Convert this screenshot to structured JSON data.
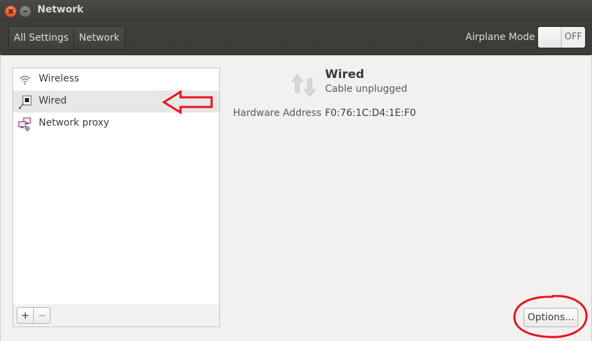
{
  "window": {
    "title": "Network"
  },
  "toolbar": {
    "breadcrumbs": [
      {
        "label": "All Settings"
      },
      {
        "label": "Network"
      }
    ],
    "airplane_mode": {
      "label": "Airplane Mode",
      "state": "OFF"
    }
  },
  "sidebar": {
    "items": [
      {
        "label": "Wireless",
        "icon": "wireless-icon",
        "selected": false
      },
      {
        "label": "Wired",
        "icon": "wired-icon",
        "selected": true
      },
      {
        "label": "Network proxy",
        "icon": "network-proxy-icon",
        "selected": false
      }
    ],
    "add_label": "+",
    "remove_label": "−"
  },
  "detail": {
    "title": "Wired",
    "status": "Cable unplugged",
    "icon": "network-transfer-icon",
    "hardware_address_label": "Hardware Address",
    "hardware_address_value": "F0:76:1C:D4:1E:F0"
  },
  "options_label": "Options...",
  "colors": {
    "titlebar": "#3c3b37",
    "annotation_red": "#e8121f",
    "close_button": "#e95420",
    "selected_row": "#e8e7e6"
  }
}
